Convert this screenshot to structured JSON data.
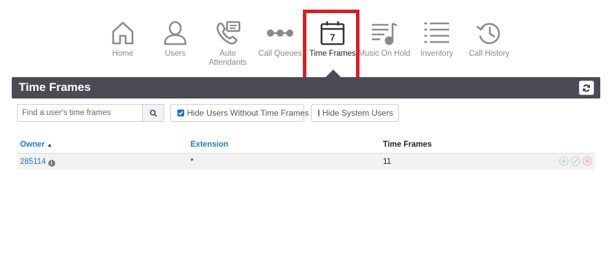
{
  "nav": {
    "items": [
      {
        "label": "Home",
        "icon": "home-icon"
      },
      {
        "label": "Users",
        "icon": "user-icon"
      },
      {
        "label": "Auto Attendants",
        "icon": "auto-attendant-icon"
      },
      {
        "label": "Call Queues",
        "icon": "call-queue-icon"
      },
      {
        "label": "Time Frames",
        "icon": "calendar-icon",
        "icon_text": "7",
        "active": true
      },
      {
        "label": "Music On Hold",
        "icon": "music-list-icon"
      },
      {
        "label": "Inventory",
        "icon": "inventory-list-icon"
      },
      {
        "label": "Call History",
        "icon": "history-icon"
      }
    ]
  },
  "header": {
    "title": "Time Frames",
    "refresh_icon": "refresh-icon"
  },
  "filters": {
    "search_placeholder": "Find a user's time frames",
    "search_icon": "search-icon",
    "hide_without_label": "Hide Users Without Time Frames",
    "hide_without_checked": true,
    "hide_system_label": "Hide System Users",
    "hide_system_checked": false
  },
  "table": {
    "columns": {
      "owner": "Owner",
      "extension": "Extension",
      "time_frames": "Time Frames"
    },
    "sort": {
      "column": "Owner",
      "direction": "ascending"
    },
    "rows": [
      {
        "owner": "285114",
        "extension": "*",
        "time_frames": "11"
      }
    ],
    "row_action_icons": [
      "add-icon",
      "edit-icon",
      "delete-icon"
    ]
  },
  "colors": {
    "accent_link": "#1a7fc1",
    "header_bar": "#4b4b55",
    "highlight": "#e0191f"
  }
}
